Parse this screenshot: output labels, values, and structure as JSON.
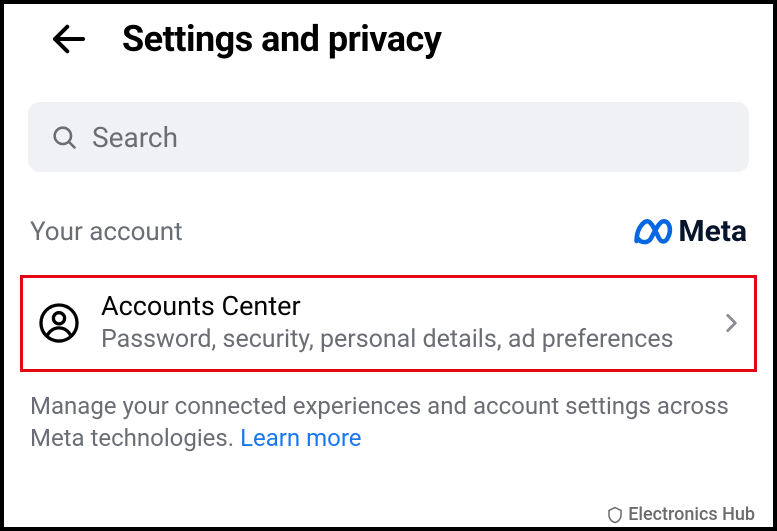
{
  "header": {
    "title": "Settings and privacy"
  },
  "search": {
    "placeholder": "Search"
  },
  "account_section": {
    "label": "Your account",
    "brand": "Meta"
  },
  "accounts_center": {
    "title": "Accounts Center",
    "subtitle": "Password, security, personal details, ad preferences"
  },
  "description": {
    "text": "Manage your connected experiences and account settings across Meta technologies. ",
    "link": "Learn more"
  },
  "watermark": {
    "text": "Electronics Hub"
  }
}
